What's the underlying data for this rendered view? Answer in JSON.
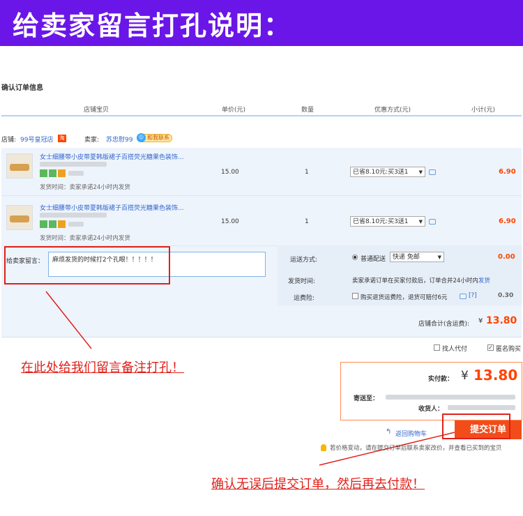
{
  "banner": {
    "title": "给卖家留言打孔说明："
  },
  "section": {
    "title": "确认订单信息"
  },
  "columns": {
    "item": "店铺宝贝",
    "price": "单价(元)",
    "qty": "数量",
    "discount": "优惠方式(元)",
    "subtotal": "小计(元)"
  },
  "store": {
    "label": "店铺:",
    "name": "99号皇冠店",
    "tao_badge": "淘",
    "seller_label": "卖家:",
    "seller_name": "苏忠慰99",
    "contact_label": "和我联系"
  },
  "items": [
    {
      "title": "女士细腰带小皮带夏韩版裙子百搭荧光糖果色装饰...",
      "ship_note": "发货时间：卖家承诺24小时内发货",
      "price": "15.00",
      "qty": "1",
      "discount": "已省8.10元:买3送1",
      "subtotal": "6.90"
    },
    {
      "title": "女士细腰带小皮带夏韩版裙子百搭荧光糖果色装饰...",
      "ship_note": "发货时间：卖家承诺24小时内发货",
      "price": "15.00",
      "qty": "1",
      "discount": "已省8.10元:买3送1",
      "subtotal": "6.90"
    }
  ],
  "message": {
    "label": "给卖家留言：",
    "value": "麻烦发货的时候打2个孔眼！！！！！"
  },
  "shipping": {
    "method_label": "运送方式:",
    "method_option": "普通配送",
    "method_select": "快递 免邮",
    "method_cost": "0.00",
    "time_label": "发货时间:",
    "time_text": "卖家承诺订单在买家付款后，订单合并24小时内",
    "time_link": "发货",
    "insurance_label": "运费险:",
    "insurance_text": "购买退货运费险，退货可赔付6元",
    "insurance_help": "[?]",
    "insurance_cost": "0.30"
  },
  "totals": {
    "store_total_label": "店铺合计(含运费):",
    "store_total_currency": "¥",
    "store_total_value": "13.80"
  },
  "options": {
    "proxy_pay": "找人代付",
    "anonymous": "匿名购买"
  },
  "payment": {
    "paid_label": "实付款：",
    "currency": "¥",
    "paid_value": "13.80",
    "ship_to_label": "寄送至：",
    "receiver_label": "收货人："
  },
  "actions": {
    "back_to_cart": "返回购物车",
    "submit": "提交订单"
  },
  "hint": "若价格变动，请在提交订单后联系卖家改价，并查看已买到的宝贝",
  "annotations": {
    "message_note": "在此处给我们留言备注打孔！",
    "submit_note": "确认无误后提交订单，然后再去付款！"
  },
  "colors": {
    "banner": "#6a16e8",
    "accent_orange": "#ff4400",
    "annotation_red": "#e0201a",
    "link_blue": "#3366cc"
  }
}
